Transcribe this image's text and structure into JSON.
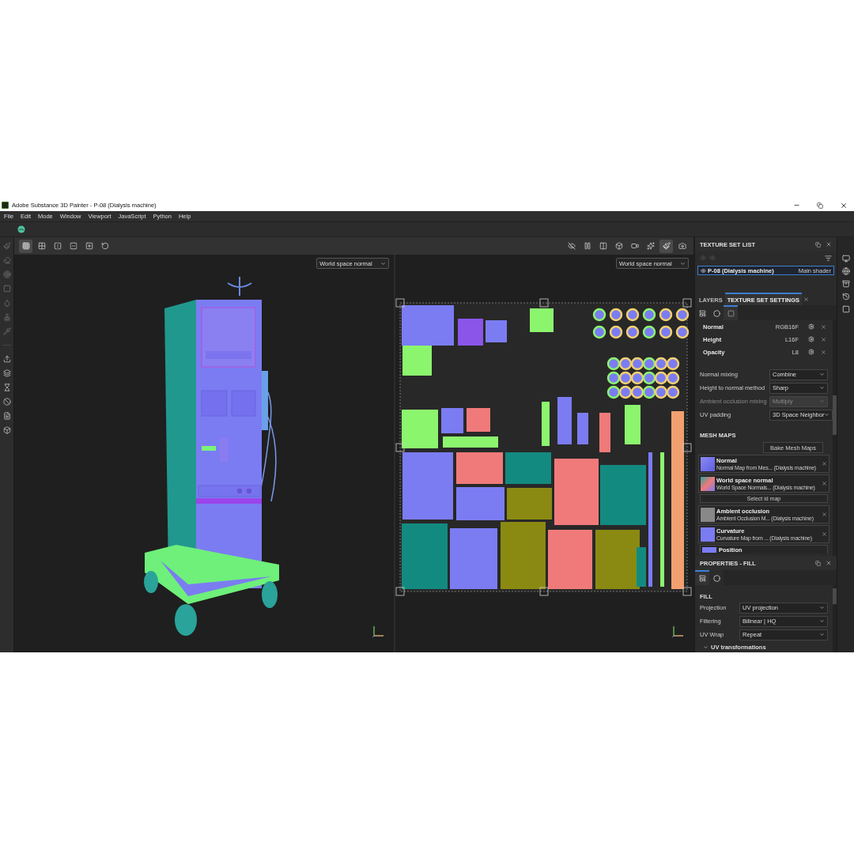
{
  "window": {
    "title": "Adobe Substance 3D Painter - P-08 (Dialysis machine)"
  },
  "menu": [
    "File",
    "Edit",
    "Mode",
    "Window",
    "Viewport",
    "JavaScript",
    "Python",
    "Help"
  ],
  "viewport_toolbar": {
    "left": [
      {
        "selected": true
      },
      {
        "selected": false
      },
      {
        "selected": false
      },
      {
        "selected": false
      },
      {
        "selected": false
      },
      {
        "selected": false
      }
    ],
    "right": [
      {
        "selected": false
      },
      {
        "selected": false
      },
      {
        "selected": false
      },
      {
        "selected": false
      },
      {
        "selected": false
      },
      {
        "selected": false
      },
      {
        "selected": true
      },
      {
        "selected": false
      }
    ]
  },
  "viewports": [
    {
      "kind": "model",
      "channel": "World space normal"
    },
    {
      "kind": "uv",
      "channel": "World space normal"
    }
  ],
  "texture_set_list": {
    "title": "TEXTURE SET LIST",
    "items": [
      {
        "name": "P-08 (Dialysis machine)",
        "shader": "Main shader",
        "selected": true
      }
    ]
  },
  "tabs": [
    {
      "label": "LAYERS",
      "selected": false,
      "closable": false
    },
    {
      "label": "TEXTURE SET SETTINGS",
      "selected": true,
      "closable": true
    }
  ],
  "settings_tabs": [
    {
      "selected": false
    },
    {
      "selected": false
    },
    {
      "selected": true
    }
  ],
  "channels": [
    {
      "name": "Normal",
      "format": "RGB16F"
    },
    {
      "name": "Height",
      "format": "L16F"
    },
    {
      "name": "Opacity",
      "format": "L8"
    }
  ],
  "settings": [
    {
      "label": "Normal mixing",
      "value": "Combine",
      "disabled": false
    },
    {
      "label": "Height to normal method",
      "value": "Sharp",
      "disabled": false
    },
    {
      "label": "Ambient occlusion mixing",
      "value": "Multiply",
      "disabled": true
    },
    {
      "label": "UV padding",
      "value": "3D Space Neighbor",
      "disabled": false
    }
  ],
  "mesh_maps": {
    "title": "MESH MAPS",
    "bake_button": "Bake Mesh Maps",
    "items": [
      {
        "kind": "map",
        "name": "Normal",
        "source": "Normal Map from Mes... (Dialysis machine)"
      },
      {
        "kind": "map",
        "name": "World space normal",
        "source": "World Space Normals... (Dialysis machine)"
      },
      {
        "kind": "button",
        "label": "Select id map"
      },
      {
        "kind": "map",
        "name": "Ambient occlusion",
        "source": "Ambient Occlusion M... (Dialysis machine)"
      },
      {
        "kind": "map",
        "name": "Curvature",
        "source": "Curvature Map from ... (Dialysis machine)"
      },
      {
        "kind": "partial",
        "name": "Position"
      }
    ]
  },
  "properties": {
    "title": "PROPERTIES - FILL",
    "tabs": [
      {
        "selected": true
      },
      {
        "selected": false
      }
    ],
    "section": "FILL",
    "fields": [
      {
        "label": "Projection",
        "value": "UV projection"
      },
      {
        "label": "Filtering",
        "value": "Bilinear | HQ"
      },
      {
        "label": "UV Wrap",
        "value": "Repeat"
      }
    ],
    "group": {
      "label": "UV transformations",
      "expanded": true
    }
  }
}
